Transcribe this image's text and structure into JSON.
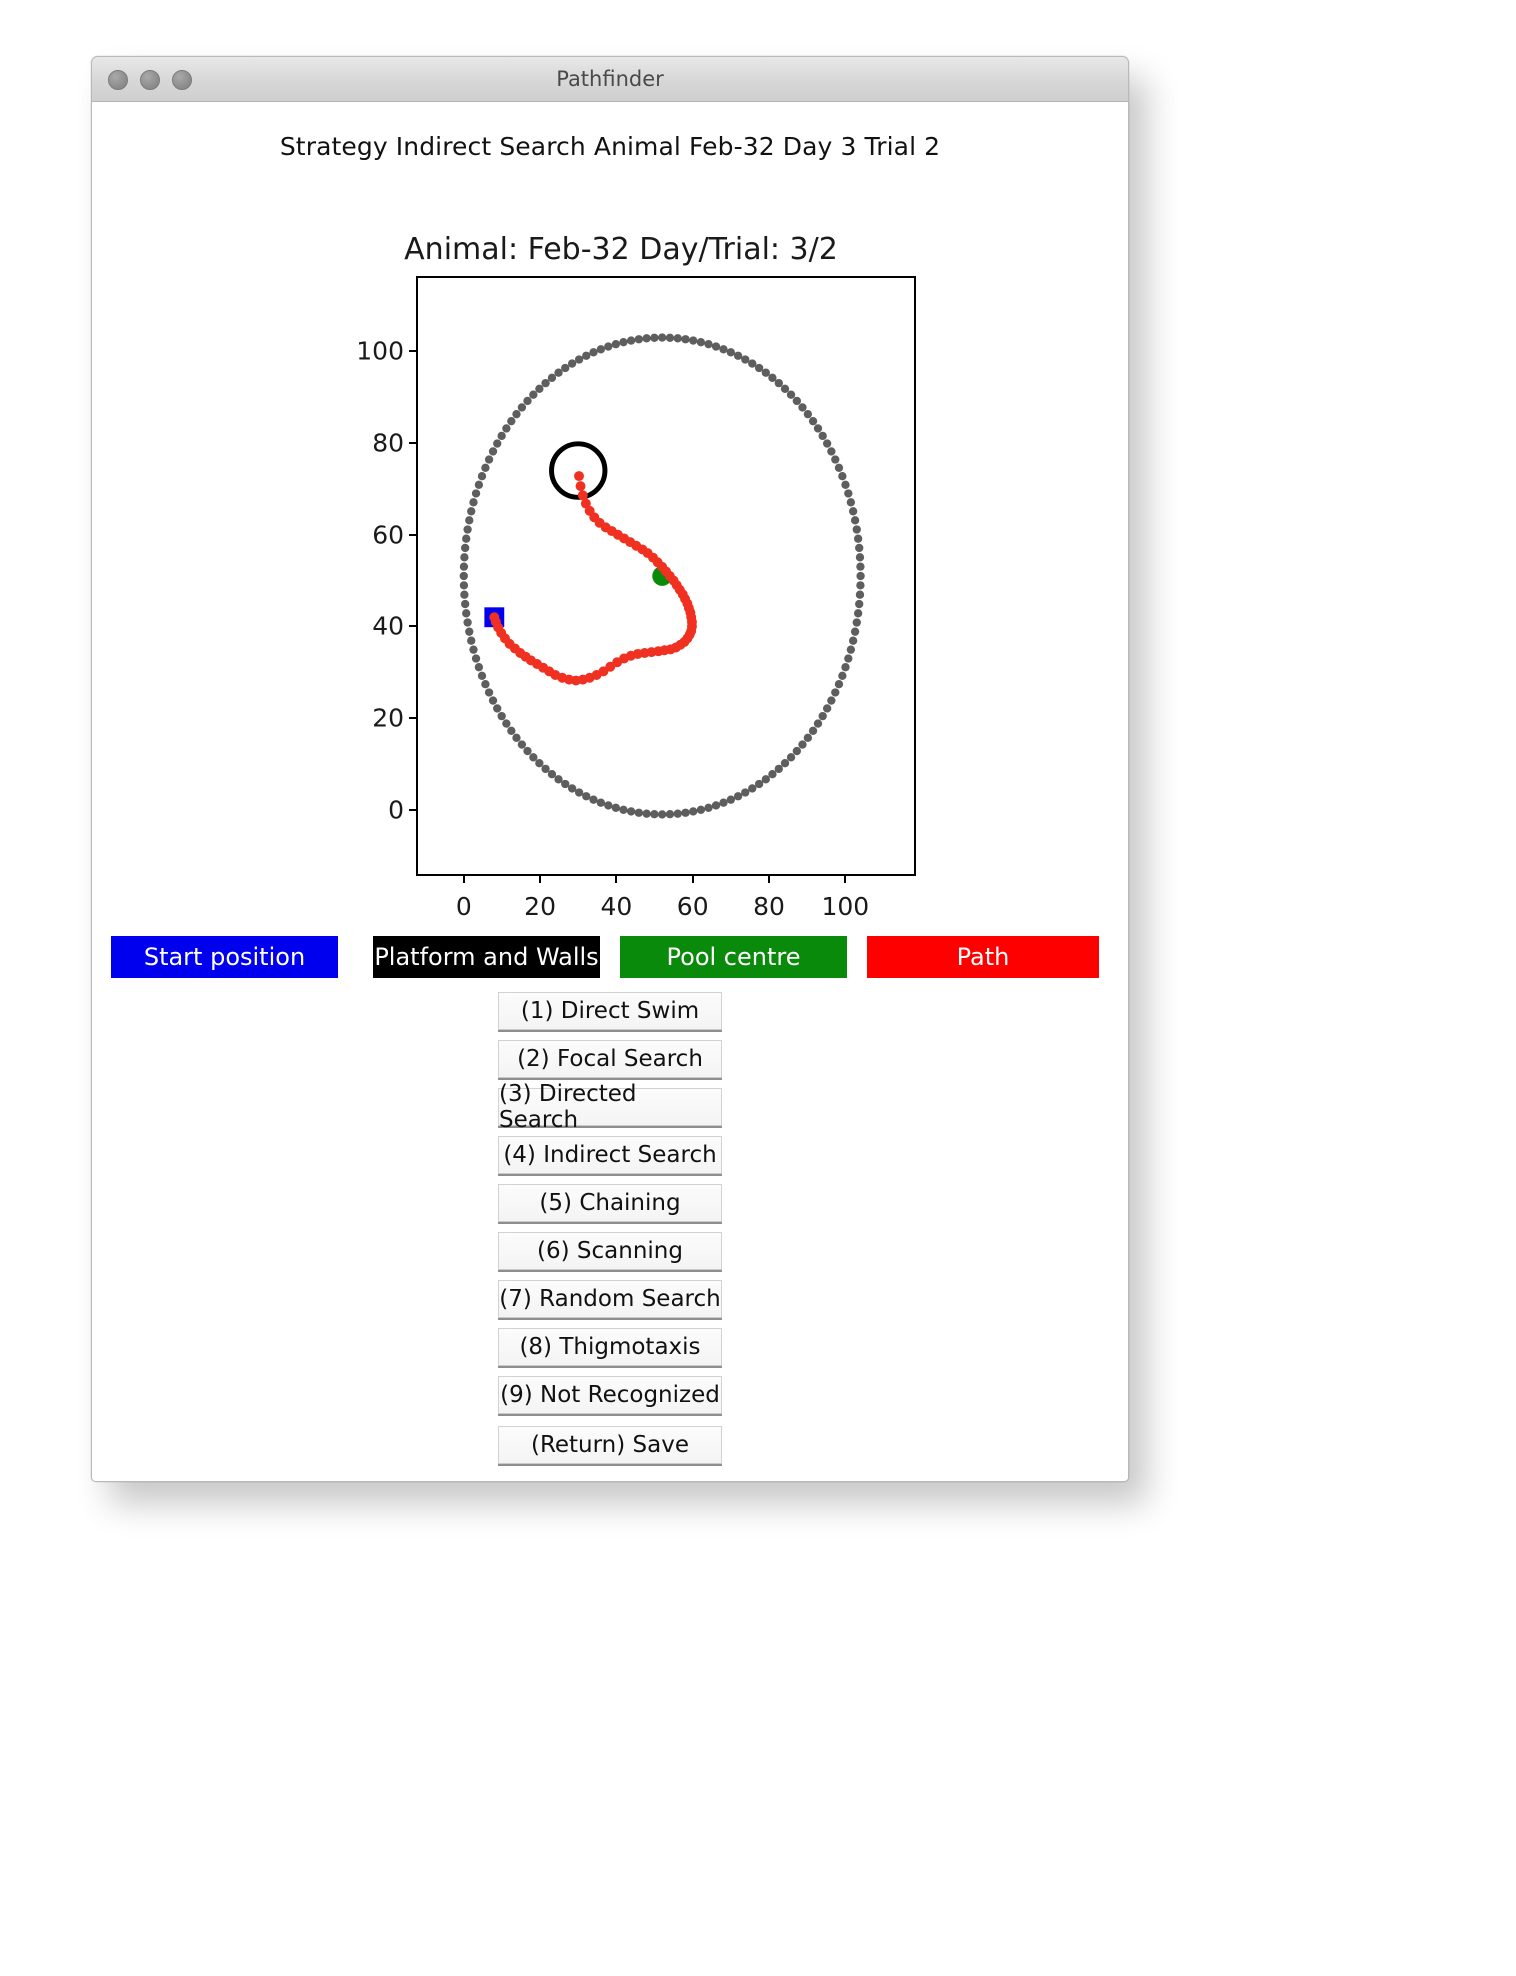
{
  "window": {
    "title": "Pathfinder",
    "traffic_lights": [
      "close-button",
      "minimize-button",
      "zoom-button"
    ]
  },
  "header": {
    "status_line": "Strategy Indirect Search Animal Feb-32  Day 3 Trial 2"
  },
  "figure": {
    "title": "Animal: Feb-32  Day/Trial: 3/2"
  },
  "legend": [
    {
      "name": "start-position",
      "label": "Start position",
      "color": "#0000ee",
      "text_color": "#ffffff"
    },
    {
      "name": "platform-and-walls",
      "label": "Platform and Walls",
      "color": "#000000",
      "text_color": "#ffffff"
    },
    {
      "name": "pool-centre",
      "label": "Pool centre",
      "color": "#0a8a0a",
      "text_color": "#ffffff"
    },
    {
      "name": "path",
      "label": "Path",
      "color": "#ff0000",
      "text_color": "#ffffff"
    }
  ],
  "buttons": [
    {
      "name": "strategy-direct-swim",
      "label": "(1) Direct Swim"
    },
    {
      "name": "strategy-focal-search",
      "label": "(2) Focal Search"
    },
    {
      "name": "strategy-directed-search",
      "label": "(3) Directed Search"
    },
    {
      "name": "strategy-indirect-search",
      "label": "(4) Indirect Search"
    },
    {
      "name": "strategy-chaining",
      "label": "(5) Chaining"
    },
    {
      "name": "strategy-scanning",
      "label": "(6) Scanning"
    },
    {
      "name": "strategy-random-search",
      "label": "(7) Random Search"
    },
    {
      "name": "strategy-thigmotaxis",
      "label": "(8) Thigmotaxis"
    },
    {
      "name": "strategy-not-recognized",
      "label": "(9) Not Recognized"
    },
    {
      "name": "save-button",
      "label": "(Return) Save"
    }
  ],
  "chart_data": {
    "type": "scatter",
    "title": "Animal: Feb-32  Day/Trial: 3/2",
    "xlabel": "",
    "ylabel": "",
    "xlim": [
      -12,
      118
    ],
    "xticks": [
      0,
      20,
      40,
      60,
      80,
      100
    ],
    "ylim": [
      -14,
      116
    ],
    "yticks": [
      0,
      20,
      40,
      60,
      80,
      100
    ],
    "grid": false,
    "legend_position": "below-plot",
    "series": [
      {
        "name": "Platform and Walls",
        "kind": "pool-wall-circle",
        "color": "#4d4d4d",
        "marker": "o",
        "centre": [
          52,
          51
        ],
        "radius": 52,
        "n_points": 160
      },
      {
        "name": "Platform",
        "kind": "platform-circle-outline",
        "color": "#000000",
        "centre": [
          30,
          74
        ],
        "radius": 7
      },
      {
        "name": "Pool centre",
        "kind": "point",
        "color": "#0a8a0a",
        "marker": "o",
        "x": [
          52
        ],
        "y": [
          51
        ]
      },
      {
        "name": "Start position",
        "kind": "point",
        "color": "#0000ee",
        "marker": "s",
        "x": [
          8
        ],
        "y": [
          42
        ]
      },
      {
        "name": "Path",
        "kind": "trajectory",
        "color": "#f03020",
        "marker": "o",
        "x": [
          30.2,
          30.6,
          31.2,
          32.0,
          33.0,
          34.2,
          35.6,
          37.2,
          38.8,
          40.4,
          42.0,
          43.6,
          45.2,
          46.8,
          48.2,
          49.6,
          50.8,
          52.0,
          53.0,
          54.0,
          55.0,
          55.8,
          56.6,
          57.4,
          58.0,
          58.6,
          59.0,
          59.4,
          59.6,
          59.8,
          59.8,
          59.6,
          59.2,
          58.6,
          57.8,
          56.8,
          55.6,
          54.2,
          52.6,
          51.0,
          49.2,
          47.4,
          45.6,
          43.8,
          42.0,
          40.2,
          38.4,
          36.6,
          34.8,
          33.0,
          31.2,
          29.4,
          27.6,
          25.8,
          24.0,
          22.4,
          20.8,
          19.2,
          17.6,
          16.2,
          14.8,
          13.4,
          12.0,
          10.8,
          9.8,
          9.0,
          8.4,
          8.0
        ],
        "y": [
          72.8,
          70.6,
          68.6,
          66.8,
          65.2,
          63.8,
          62.6,
          61.6,
          60.8,
          60.0,
          59.2,
          58.4,
          57.6,
          56.8,
          56.0,
          55.0,
          54.0,
          53.0,
          52.0,
          51.0,
          50.0,
          49.0,
          48.0,
          47.0,
          46.0,
          45.0,
          44.0,
          43.0,
          42.0,
          41.0,
          40.0,
          39.0,
          38.2,
          37.4,
          36.6,
          36.0,
          35.4,
          35.0,
          34.8,
          34.6,
          34.4,
          34.2,
          34.0,
          33.6,
          33.0,
          32.2,
          31.2,
          30.2,
          29.4,
          28.8,
          28.4,
          28.2,
          28.4,
          28.8,
          29.4,
          30.2,
          31.0,
          31.8,
          32.6,
          33.4,
          34.2,
          35.2,
          36.2,
          37.4,
          38.6,
          39.8,
          41.0,
          42.0
        ]
      }
    ]
  }
}
